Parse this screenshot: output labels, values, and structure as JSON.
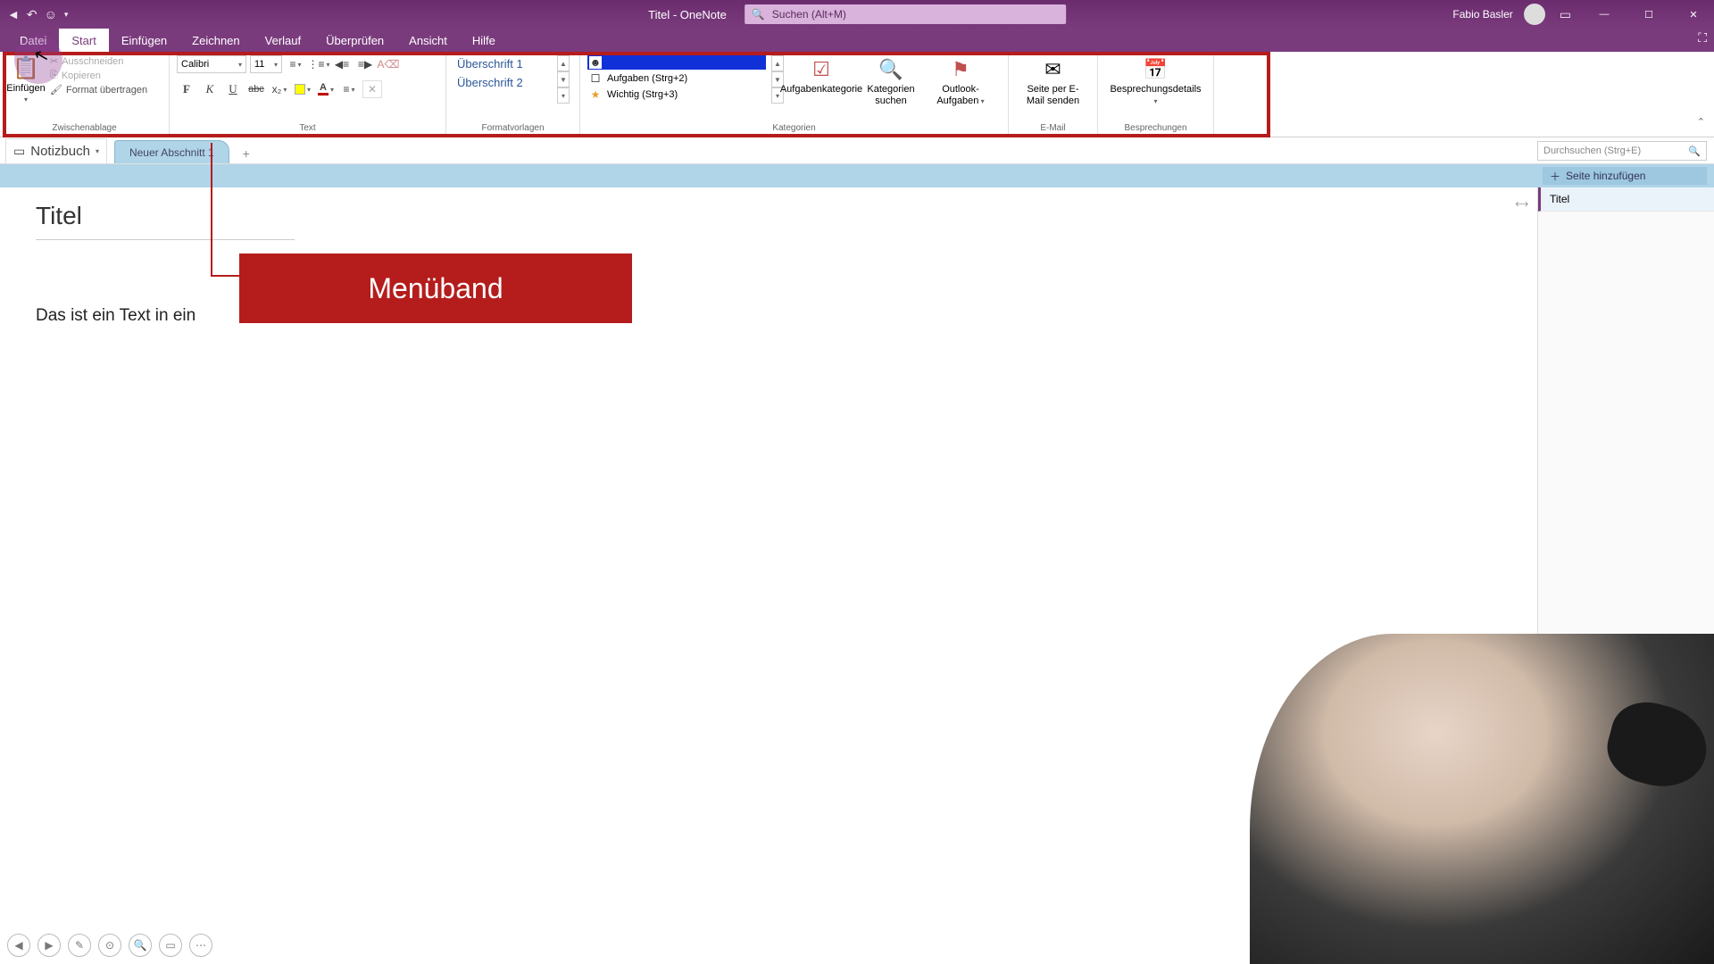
{
  "titlebar": {
    "title": "Titel  -  OneNote",
    "search_placeholder": "Suchen (Alt+M)",
    "user_name": "Fabio Basler"
  },
  "menu": {
    "tabs": [
      "Datei",
      "Start",
      "Einfügen",
      "Zeichnen",
      "Verlauf",
      "Überprüfen",
      "Ansicht",
      "Hilfe"
    ],
    "active_index": 1
  },
  "ribbon": {
    "clipboard": {
      "paste": "Einfügen",
      "cut": "Ausschneiden",
      "copy": "Kopieren",
      "format_painter": "Format übertragen",
      "group_label": "Zwischenablage"
    },
    "text": {
      "font": "Calibri",
      "size": "11",
      "group_label": "Text"
    },
    "styles": {
      "h1": "Überschrift 1",
      "h2": "Überschrift 2",
      "group_label": "Formatvorlagen"
    },
    "tags": {
      "item1": "",
      "item2": "Aufgaben (Strg+2)",
      "item3": "Wichtig (Strg+3)",
      "task_category": "Aufgabenkategorie",
      "find_tags": "Kategorien suchen",
      "outlook_tasks": "Outlook-Aufgaben",
      "group_label": "Kategorien"
    },
    "email": {
      "send": "Seite per E-Mail senden",
      "group_label": "E-Mail"
    },
    "meetings": {
      "details": "Besprechungsdetails",
      "group_label": "Besprechungen"
    }
  },
  "notebook": {
    "label": "Notizbuch",
    "section_tab": "Neuer Abschnitt 1",
    "search_placeholder": "Durchsuchen (Strg+E)",
    "add_page": "Seite hinzufügen",
    "page_list_item": "Titel"
  },
  "page": {
    "title": "Titel",
    "body": "Das ist ein Text in ein"
  },
  "annotation": {
    "label": "Menüband"
  }
}
